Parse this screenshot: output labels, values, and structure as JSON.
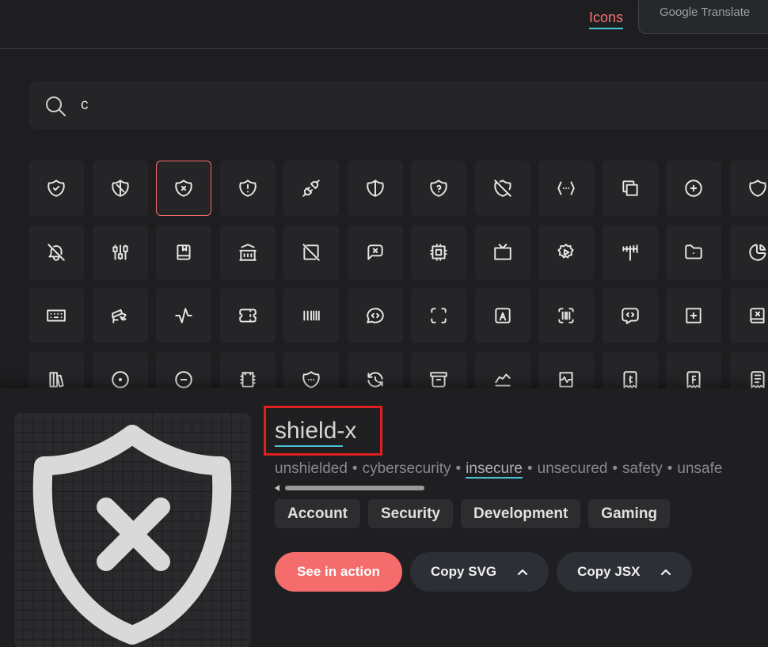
{
  "header": {
    "nav_icons_label": "Icons",
    "popup_label": "Google Translate"
  },
  "search": {
    "value": "c"
  },
  "grid": {
    "icons": [
      [
        "shield-check",
        "shield-half",
        "shield-x",
        "shield-exclamation",
        "plug-connected",
        "shield-half-vertical",
        "shield-question",
        "shield-off",
        "code-dots",
        "copy",
        "circle-plus",
        "shield"
      ],
      [
        "bell-off",
        "chart-candle",
        "bookmark-book",
        "building-bank",
        "device-off",
        "message-x",
        "cpu",
        "device-tv",
        "settings-play",
        "antenna",
        "folder-dot",
        "chart-pie"
      ],
      [
        "keyboard",
        "cctv",
        "activity",
        "ticket",
        "barcode",
        "message-code",
        "frame",
        "address-book",
        "scan",
        "message-code-square",
        "square-plus",
        "book-x"
      ],
      [
        "books",
        "circle-dot",
        "circle-minus",
        "film",
        "shield-dots",
        "refresh-clock",
        "archive",
        "chart-line",
        "report-pulse",
        "receipt-cent",
        "receipt-franc",
        "receipt"
      ]
    ],
    "selected": "shield-x"
  },
  "detail": {
    "name": "shield-x",
    "tags": [
      "unshielded",
      "cybersecurity",
      "insecure",
      "unsecured",
      "safety",
      "unsafe"
    ],
    "highlighted_tag": "insecure",
    "categories": [
      "Account",
      "Security",
      "Development",
      "Gaming"
    ],
    "see_in_action_label": "See in action",
    "copy_svg_label": "Copy SVG",
    "copy_jsx_label": "Copy JSX"
  },
  "colors": {
    "accent": "#f46c6c",
    "underline": "#4cc3d9",
    "highlight_box": "#e01f1f"
  }
}
